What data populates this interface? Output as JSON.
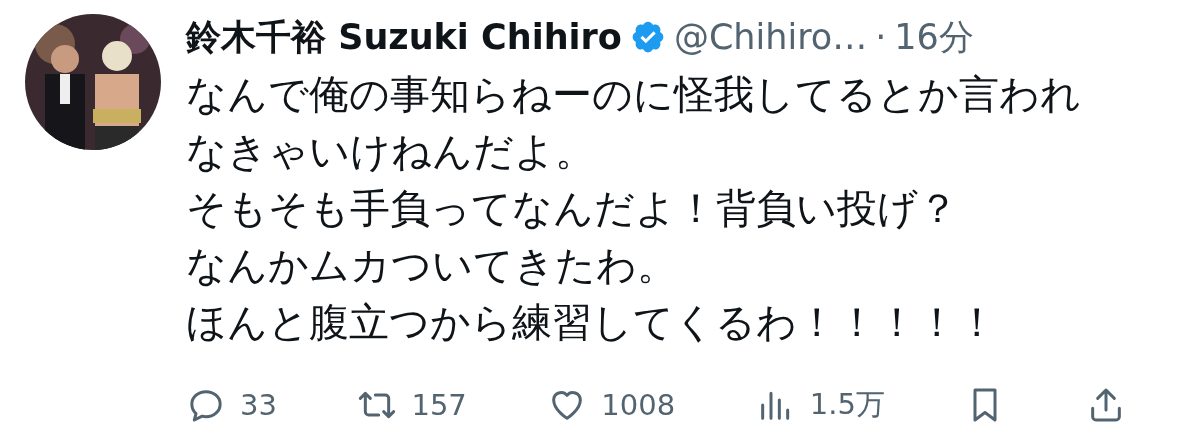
{
  "author": {
    "name_ja": "鈴木千裕",
    "name": "Suzuki Chihiro",
    "verified": true,
    "handle": "@Chihiro…",
    "separator": "·",
    "time": "16分"
  },
  "body": [
    "なんで俺の事知らねーのに怪我してるとか言われなきゃいけねんだよ。",
    "そもそも手負ってなんだよ！背負い投げ？",
    "なんかムカついてきたわ。",
    "ほんと腹立つから練習してくるわ！！！！！"
  ],
  "actions": [
    {
      "kind": "reply",
      "count": "33"
    },
    {
      "kind": "repost",
      "count": "157"
    },
    {
      "kind": "like",
      "count": "1008"
    },
    {
      "kind": "views",
      "count": "1.5万"
    },
    {
      "kind": "bookmark"
    },
    {
      "kind": "share"
    }
  ]
}
